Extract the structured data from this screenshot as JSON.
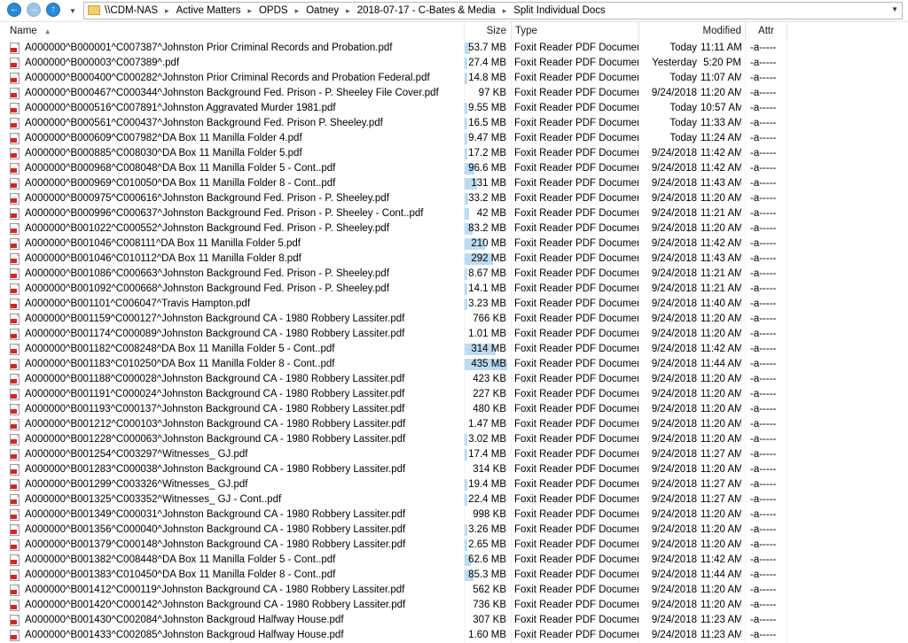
{
  "address": {
    "crumbs": [
      "\\\\CDM-NAS",
      "Active Matters",
      "OPDS",
      "Oatney",
      "2018-07-17 - C-Bates & Media",
      "Split Individual Docs"
    ]
  },
  "columns": {
    "name": "Name",
    "size": "Size",
    "type": "Type",
    "modified": "Modified",
    "attr": "Attr"
  },
  "files": [
    {
      "name": "A000000^B000001^C007387^Johnston Prior Criminal Records and Probation.pdf",
      "size": "53.7 MB",
      "type": "Foxit Reader PDF Document",
      "date": "Today",
      "time": "11:11 AM",
      "attr": "-a-----",
      "bar": 0.12
    },
    {
      "name": "A000000^B000003^C007389^.pdf",
      "size": "27.4 MB",
      "type": "Foxit Reader PDF Document",
      "date": "Yesterday",
      "time": "5:20 PM",
      "attr": "-a-----",
      "bar": 0.06
    },
    {
      "name": "A000000^B000400^C000282^Johnston Prior Criminal Records and Probation Federal.pdf",
      "size": "14.8 MB",
      "type": "Foxit Reader PDF Document",
      "date": "Today",
      "time": "11:07 AM",
      "attr": "-a-----",
      "bar": 0.03
    },
    {
      "name": "A000000^B000467^C000344^Johnston Background Fed. Prison - P. Sheeley File Cover.pdf",
      "size": "97 KB",
      "type": "Foxit Reader PDF Document",
      "date": "9/24/2018",
      "time": "11:20 AM",
      "attr": "-a-----",
      "bar": 0
    },
    {
      "name": "A000000^B000516^C007891^Johnston Aggravated Murder 1981.pdf",
      "size": "9.55 MB",
      "type": "Foxit Reader PDF Document",
      "date": "Today",
      "time": "10:57 AM",
      "attr": "-a-----",
      "bar": 0.02
    },
    {
      "name": "A000000^B000561^C000437^Johnston Background Fed. Prison P. Sheeley.pdf",
      "size": "16.5 MB",
      "type": "Foxit Reader PDF Document",
      "date": "Today",
      "time": "11:33 AM",
      "attr": "-a-----",
      "bar": 0.04
    },
    {
      "name": "A000000^B000609^C007982^DA Box 11 Manilla Folder 4.pdf",
      "size": "9.47 MB",
      "type": "Foxit Reader PDF Document",
      "date": "Today",
      "time": "11:24 AM",
      "attr": "-a-----",
      "bar": 0.02
    },
    {
      "name": "A000000^B000885^C008030^DA Box 11 Manilla Folder 5.pdf",
      "size": "17.2 MB",
      "type": "Foxit Reader PDF Document",
      "date": "9/24/2018",
      "time": "11:42 AM",
      "attr": "-a-----",
      "bar": 0.04
    },
    {
      "name": "A000000^B000968^C008048^DA Box 11 Manilla Folder 5 - Cont..pdf",
      "size": "96.6 MB",
      "type": "Foxit Reader PDF Document",
      "date": "9/24/2018",
      "time": "11:42 AM",
      "attr": "-a-----",
      "bar": 0.22
    },
    {
      "name": "A000000^B000969^C010050^DA Box 11 Manilla Folder 8 - Cont..pdf",
      "size": "131 MB",
      "type": "Foxit Reader PDF Document",
      "date": "9/24/2018",
      "time": "11:43 AM",
      "attr": "-a-----",
      "bar": 0.3
    },
    {
      "name": "A000000^B000975^C000616^Johnston Background Fed. Prison - P. Sheeley.pdf",
      "size": "33.2 MB",
      "type": "Foxit Reader PDF Document",
      "date": "9/24/2018",
      "time": "11:20 AM",
      "attr": "-a-----",
      "bar": 0.08
    },
    {
      "name": "A000000^B000996^C000637^Johnston Background Fed. Prison - P. Sheeley - Cont..pdf",
      "size": "42 MB",
      "type": "Foxit Reader PDF Document",
      "date": "9/24/2018",
      "time": "11:21 AM",
      "attr": "-a-----",
      "bar": 0.1
    },
    {
      "name": "A000000^B001022^C000552^Johnston Background Fed. Prison - P. Sheeley.pdf",
      "size": "83.2 MB",
      "type": "Foxit Reader PDF Document",
      "date": "9/24/2018",
      "time": "11:20 AM",
      "attr": "-a-----",
      "bar": 0.19
    },
    {
      "name": "A000000^B001046^C008111^DA Box 11 Manilla Folder 5.pdf",
      "size": "210 MB",
      "type": "Foxit Reader PDF Document",
      "date": "9/24/2018",
      "time": "11:42 AM",
      "attr": "-a-----",
      "bar": 0.48
    },
    {
      "name": "A000000^B001046^C010112^DA Box 11 Manilla Folder 8.pdf",
      "size": "292 MB",
      "type": "Foxit Reader PDF Document",
      "date": "9/24/2018",
      "time": "11:43 AM",
      "attr": "-a-----",
      "bar": 0.67
    },
    {
      "name": "A000000^B001086^C000663^Johnston Background Fed. Prison - P. Sheeley.pdf",
      "size": "8.67 MB",
      "type": "Foxit Reader PDF Document",
      "date": "9/24/2018",
      "time": "11:21 AM",
      "attr": "-a-----",
      "bar": 0.02
    },
    {
      "name": "A000000^B001092^C000668^Johnston Background Fed. Prison - P. Sheeley.pdf",
      "size": "14.1 MB",
      "type": "Foxit Reader PDF Document",
      "date": "9/24/2018",
      "time": "11:21 AM",
      "attr": "-a-----",
      "bar": 0.03
    },
    {
      "name": "A000000^B001101^C006047^Travis Hampton.pdf",
      "size": "3.23 MB",
      "type": "Foxit Reader PDF Document",
      "date": "9/24/2018",
      "time": "11:40 AM",
      "attr": "-a-----",
      "bar": 0.01
    },
    {
      "name": "A000000^B001159^C000127^Johnston Background CA - 1980 Robbery Lassiter.pdf",
      "size": "766 KB",
      "type": "Foxit Reader PDF Document",
      "date": "9/24/2018",
      "time": "11:20 AM",
      "attr": "-a-----",
      "bar": 0
    },
    {
      "name": "A000000^B001174^C000089^Johnston Background CA - 1980 Robbery Lassiter.pdf",
      "size": "1.01 MB",
      "type": "Foxit Reader PDF Document",
      "date": "9/24/2018",
      "time": "11:20 AM",
      "attr": "-a-----",
      "bar": 0
    },
    {
      "name": "A000000^B001182^C008248^DA Box 11 Manilla Folder 5 - Cont..pdf",
      "size": "314 MB",
      "type": "Foxit Reader PDF Document",
      "date": "9/24/2018",
      "time": "11:42 AM",
      "attr": "-a-----",
      "bar": 0.72
    },
    {
      "name": "A000000^B001183^C010250^DA Box 11 Manilla Folder 8 - Cont..pdf",
      "size": "435 MB",
      "type": "Foxit Reader PDF Document",
      "date": "9/24/2018",
      "time": "11:44 AM",
      "attr": "-a-----",
      "bar": 1.0
    },
    {
      "name": "A000000^B001188^C000028^Johnston Background CA - 1980 Robbery Lassiter.pdf",
      "size": "423 KB",
      "type": "Foxit Reader PDF Document",
      "date": "9/24/2018",
      "time": "11:20 AM",
      "attr": "-a-----",
      "bar": 0
    },
    {
      "name": "A000000^B001191^C000024^Johnston Background CA - 1980 Robbery Lassiter.pdf",
      "size": "227 KB",
      "type": "Foxit Reader PDF Document",
      "date": "9/24/2018",
      "time": "11:20 AM",
      "attr": "-a-----",
      "bar": 0
    },
    {
      "name": "A000000^B001193^C000137^Johnston Background CA - 1980 Robbery Lassiter.pdf",
      "size": "480 KB",
      "type": "Foxit Reader PDF Document",
      "date": "9/24/2018",
      "time": "11:20 AM",
      "attr": "-a-----",
      "bar": 0
    },
    {
      "name": "A000000^B001212^C000103^Johnston Background CA - 1980 Robbery Lassiter.pdf",
      "size": "1.47 MB",
      "type": "Foxit Reader PDF Document",
      "date": "9/24/2018",
      "time": "11:20 AM",
      "attr": "-a-----",
      "bar": 0
    },
    {
      "name": "A000000^B001228^C000063^Johnston Background CA - 1980 Robbery Lassiter.pdf",
      "size": "3.02 MB",
      "type": "Foxit Reader PDF Document",
      "date": "9/24/2018",
      "time": "11:20 AM",
      "attr": "-a-----",
      "bar": 0.01
    },
    {
      "name": "A000000^B001254^C003297^Witnesses_ GJ.pdf",
      "size": "17.4 MB",
      "type": "Foxit Reader PDF Document",
      "date": "9/24/2018",
      "time": "11:27 AM",
      "attr": "-a-----",
      "bar": 0.04
    },
    {
      "name": "A000000^B001283^C000038^Johnston Background CA - 1980 Robbery Lassiter.pdf",
      "size": "314 KB",
      "type": "Foxit Reader PDF Document",
      "date": "9/24/2018",
      "time": "11:20 AM",
      "attr": "-a-----",
      "bar": 0
    },
    {
      "name": "A000000^B001299^C003326^Witnesses_ GJ.pdf",
      "size": "19.4 MB",
      "type": "Foxit Reader PDF Document",
      "date": "9/24/2018",
      "time": "11:27 AM",
      "attr": "-a-----",
      "bar": 0.04
    },
    {
      "name": "A000000^B001325^C003352^Witnesses_ GJ - Cont..pdf",
      "size": "22.4 MB",
      "type": "Foxit Reader PDF Document",
      "date": "9/24/2018",
      "time": "11:27 AM",
      "attr": "-a-----",
      "bar": 0.05
    },
    {
      "name": "A000000^B001349^C000031^Johnston Background CA - 1980 Robbery Lassiter.pdf",
      "size": "998 KB",
      "type": "Foxit Reader PDF Document",
      "date": "9/24/2018",
      "time": "11:20 AM",
      "attr": "-a-----",
      "bar": 0
    },
    {
      "name": "A000000^B001356^C000040^Johnston Background CA - 1980 Robbery Lassiter.pdf",
      "size": "3.26 MB",
      "type": "Foxit Reader PDF Document",
      "date": "9/24/2018",
      "time": "11:20 AM",
      "attr": "-a-----",
      "bar": 0.01
    },
    {
      "name": "A000000^B001379^C000148^Johnston Background CA - 1980 Robbery Lassiter.pdf",
      "size": "2.65 MB",
      "type": "Foxit Reader PDF Document",
      "date": "9/24/2018",
      "time": "11:20 AM",
      "attr": "-a-----",
      "bar": 0.01
    },
    {
      "name": "A000000^B001382^C008448^DA Box 11 Manilla Folder 5 - Cont..pdf",
      "size": "62.6 MB",
      "type": "Foxit Reader PDF Document",
      "date": "9/24/2018",
      "time": "11:42 AM",
      "attr": "-a-----",
      "bar": 0.14
    },
    {
      "name": "A000000^B001383^C010450^DA Box 11 Manilla Folder 8 - Cont..pdf",
      "size": "85.3 MB",
      "type": "Foxit Reader PDF Document",
      "date": "9/24/2018",
      "time": "11:44 AM",
      "attr": "-a-----",
      "bar": 0.2
    },
    {
      "name": "A000000^B001412^C000119^Johnston Background CA - 1980 Robbery Lassiter.pdf",
      "size": "562 KB",
      "type": "Foxit Reader PDF Document",
      "date": "9/24/2018",
      "time": "11:20 AM",
      "attr": "-a-----",
      "bar": 0
    },
    {
      "name": "A000000^B001420^C000142^Johnston Background CA - 1980 Robbery Lassiter.pdf",
      "size": "736 KB",
      "type": "Foxit Reader PDF Document",
      "date": "9/24/2018",
      "time": "11:20 AM",
      "attr": "-a-----",
      "bar": 0
    },
    {
      "name": "A000000^B001430^C002084^Johnston Backgroud Halfway House.pdf",
      "size": "307 KB",
      "type": "Foxit Reader PDF Document",
      "date": "9/24/2018",
      "time": "11:23 AM",
      "attr": "-a-----",
      "bar": 0
    },
    {
      "name": "A000000^B001433^C002085^Johnston Backgroud Halfway House.pdf",
      "size": "1.60 MB",
      "type": "Foxit Reader PDF Document",
      "date": "9/24/2018",
      "time": "11:23 AM",
      "attr": "-a-----",
      "bar": 0
    }
  ],
  "icons": {
    "back": "arrow-left-icon",
    "forward": "arrow-right-icon",
    "up": "arrow-up-icon",
    "folder": "folder-icon",
    "file": "pdf-file-icon"
  },
  "colors": {
    "nav_blue": "#2a8ad9",
    "size_bar": "#bcdcf4",
    "pdf_red": "#d8251f"
  }
}
